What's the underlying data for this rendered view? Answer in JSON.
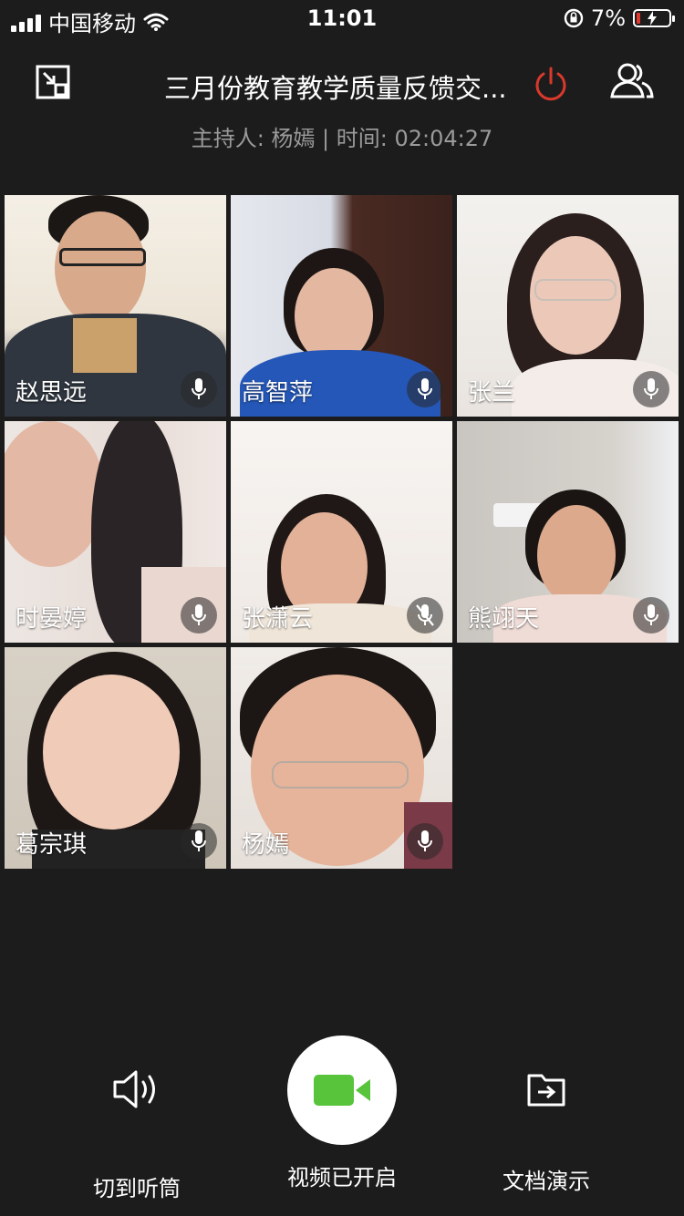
{
  "status_bar": {
    "carrier": "中国移动",
    "time": "11:01",
    "battery_percent": "7%"
  },
  "header": {
    "title": "三月份教育教学质量反馈交...",
    "subtitle": "主持人: 杨嫣 | 时间: 02:04:27"
  },
  "participants": [
    {
      "name": "赵思远",
      "muted": false
    },
    {
      "name": "高智萍",
      "muted": false
    },
    {
      "name": "张兰",
      "muted": false
    },
    {
      "name": "时晏婷",
      "muted": false
    },
    {
      "name": "张潇云",
      "muted": true
    },
    {
      "name": "熊翊天",
      "muted": false
    },
    {
      "name": "葛宗琪",
      "muted": false
    },
    {
      "name": "杨嫣",
      "muted": false
    }
  ],
  "controls": {
    "speaker_label": "切到听筒",
    "video_label": "视频已开启",
    "docs_label": "文档演示"
  },
  "colors": {
    "background": "#1c1c1c",
    "video_green": "#57c43c",
    "power_red": "#d9392c"
  }
}
